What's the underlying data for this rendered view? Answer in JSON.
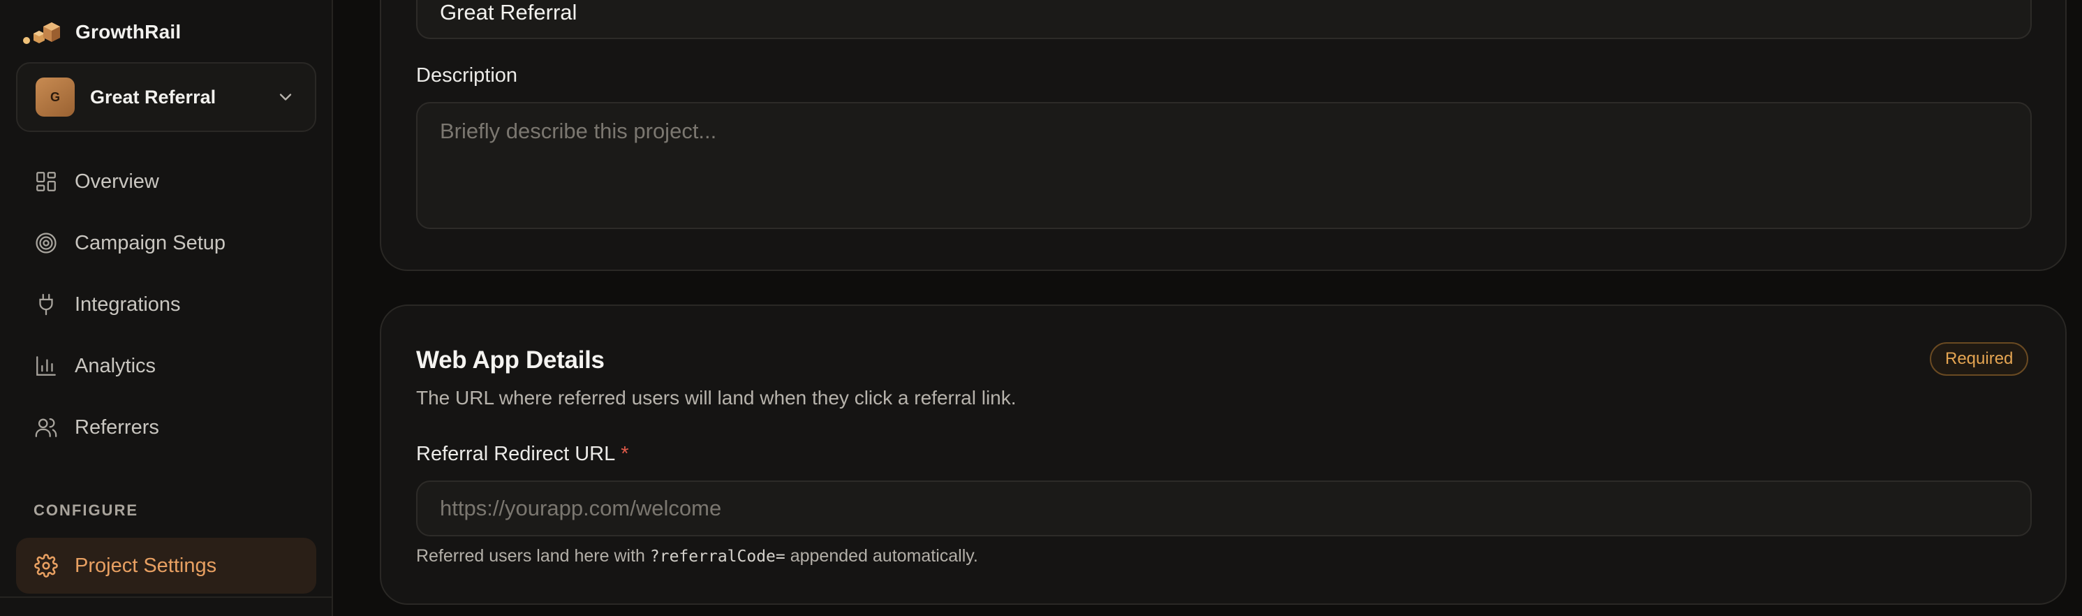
{
  "brand": {
    "name": "GrowthRail",
    "logo_icon": "stacked-cubes-icon"
  },
  "project_switcher": {
    "avatar_initial": "G",
    "name": "Great Referral",
    "chevron_icon": "chevron-down-icon"
  },
  "nav": {
    "items": [
      {
        "label": "Overview",
        "icon": "grid-icon"
      },
      {
        "label": "Campaign Setup",
        "icon": "target-icon"
      },
      {
        "label": "Integrations",
        "icon": "plug-icon"
      },
      {
        "label": "Analytics",
        "icon": "bar-chart-icon"
      },
      {
        "label": "Referrers",
        "icon": "users-icon"
      }
    ],
    "section_label": "CONFIGURE",
    "active_item": {
      "label": "Project Settings",
      "icon": "gear-icon"
    }
  },
  "project_card": {
    "name_value": "Great Referral",
    "description_label": "Description",
    "description_placeholder": "Briefly describe this project..."
  },
  "web_app_card": {
    "title": "Web App Details",
    "badge": "Required",
    "subtitle": "The URL where referred users will land when they click a referral link.",
    "url_label": "Referral Redirect URL",
    "required_marker": "*",
    "url_placeholder": "https://yourapp.com/welcome",
    "help_prefix": "Referred users land here with ",
    "help_code": "?referralCode=",
    "help_suffix": " appended automatically."
  },
  "colors": {
    "accent": "#e8a062",
    "badge": "#e5a552",
    "required_star": "#e05b4a",
    "background": "#0e0d0c",
    "sidebar": "#141312",
    "card": "#151413"
  }
}
